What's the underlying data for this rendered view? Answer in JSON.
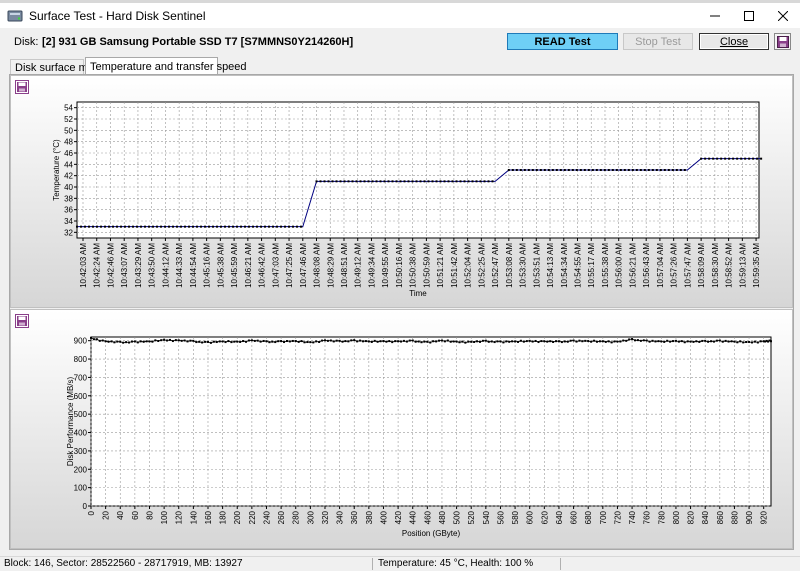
{
  "window": {
    "title": "Surface Test - Hard Disk Sentinel"
  },
  "disk": {
    "label": "Disk:",
    "name": "[2] 931 GB  Samsung Portable SSD T7 [S7MMNS0Y214260H]"
  },
  "buttons": {
    "read_test": "READ Test",
    "stop_test": "Stop Test",
    "close": "Close"
  },
  "tabs": [
    {
      "label": "Disk surface map",
      "active": false
    },
    {
      "label": "Temperature and transfer speed",
      "active": true
    }
  ],
  "icons": {
    "app": "disk-app-icon",
    "save": "floppy-save-icon",
    "minimize": "minimize-icon",
    "maximize": "maximize-icon",
    "close": "close-icon"
  },
  "colors": {
    "read_button": "#6ecff6",
    "temp_line": "#000080",
    "perf_line": "#000000"
  },
  "chart_data": [
    {
      "type": "line",
      "ylabel": "Temperature (°C)",
      "xlabel": "Time",
      "ylim": [
        31,
        55
      ],
      "y_ticks": [
        32,
        34,
        36,
        38,
        40,
        42,
        44,
        46,
        48,
        50,
        52,
        54
      ],
      "x_ticks": [
        "10:42:03 AM",
        "10:42:24 AM",
        "10:42:46 AM",
        "10:43:07 AM",
        "10:43:29 AM",
        "10:43:50 AM",
        "10:44:12 AM",
        "10:44:33 AM",
        "10:44:54 AM",
        "10:45:16 AM",
        "10:45:38 AM",
        "10:45:59 AM",
        "10:46:21 AM",
        "10:46:42 AM",
        "10:47:03 AM",
        "10:47:25 AM",
        "10:47:46 AM",
        "10:48:08 AM",
        "10:48:29 AM",
        "10:48:51 AM",
        "10:49:12 AM",
        "10:49:34 AM",
        "10:49:55 AM",
        "10:50:16 AM",
        "10:50:38 AM",
        "10:50:59 AM",
        "10:51:21 AM",
        "10:51:42 AM",
        "10:52:04 AM",
        "10:52:25 AM",
        "10:52:47 AM",
        "10:53:08 AM",
        "10:53:30 AM",
        "10:53:51 AM",
        "10:54:13 AM",
        "10:54:34 AM",
        "10:54:55 AM",
        "10:55:17 AM",
        "10:55:38 AM",
        "10:56:00 AM",
        "10:56:21 AM",
        "10:56:43 AM",
        "10:57:04 AM",
        "10:57:26 AM",
        "10:57:47 AM",
        "10:58:09 AM",
        "10:58:30 AM",
        "10:58:52 AM",
        "10:59:13 AM",
        "10:59:35 AM"
      ],
      "grid": true,
      "series": [
        {
          "segments": [
            {
              "from": "10:42:03 AM",
              "to": "10:47:46 AM",
              "value": 33
            },
            {
              "from": "10:48:08 AM",
              "to": "10:52:47 AM",
              "value": 41
            },
            {
              "from": "10:53:08 AM",
              "to": "10:57:47 AM",
              "value": 43
            },
            {
              "from": "10:58:09 AM",
              "to": "10:59:56 AM",
              "value": 45
            }
          ]
        }
      ]
    },
    {
      "type": "line",
      "ylabel": "Disk Performance (MB/s)",
      "xlabel": "Position (GByte)",
      "ylim": [
        0,
        920
      ],
      "y_ticks": [
        0,
        100,
        200,
        300,
        400,
        500,
        600,
        700,
        800,
        900
      ],
      "x_ticks": [
        0,
        20,
        40,
        60,
        80,
        100,
        120,
        140,
        160,
        180,
        200,
        220,
        240,
        260,
        280,
        300,
        320,
        340,
        360,
        380,
        400,
        420,
        440,
        460,
        480,
        500,
        520,
        540,
        560,
        580,
        600,
        620,
        640,
        660,
        680,
        700,
        720,
        740,
        760,
        780,
        800,
        820,
        840,
        860,
        880,
        900,
        920
      ],
      "xlim": [
        0,
        930
      ],
      "grid": true,
      "series": [
        {
          "x": [
            0,
            20,
            40,
            60,
            80,
            100,
            120,
            140,
            160,
            180,
            200,
            220,
            240,
            260,
            280,
            300,
            320,
            340,
            360,
            380,
            400,
            420,
            440,
            460,
            480,
            500,
            520,
            540,
            560,
            580,
            600,
            620,
            640,
            660,
            680,
            700,
            720,
            740,
            760,
            780,
            800,
            820,
            840,
            860,
            880,
            900,
            920,
            930
          ],
          "y": [
            915,
            895,
            890,
            895,
            893,
            905,
            900,
            895,
            892,
            893,
            895,
            900,
            893,
            897,
            895,
            892,
            900,
            895,
            902,
            893,
            898,
            895,
            897,
            893,
            898,
            895,
            892,
            896,
            895,
            893,
            899,
            895,
            893,
            900,
            895,
            897,
            893,
            905,
            900,
            893,
            899,
            893,
            895,
            900,
            892,
            893,
            895,
            897
          ]
        }
      ]
    }
  ],
  "status": {
    "left": "Block: 146, Sector: 28522560 - 28717919, MB: 13927",
    "right": "Temperature: 45  °C,  Health: 100 %"
  }
}
